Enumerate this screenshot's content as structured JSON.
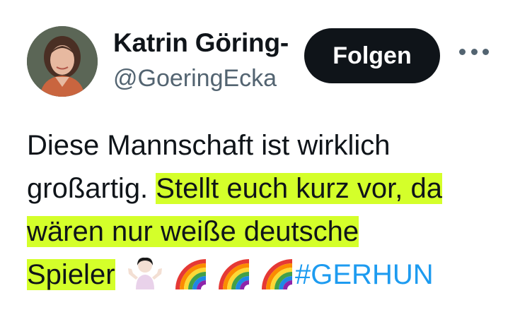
{
  "header": {
    "display_name": "Katrin Göring-",
    "handle": "@GoeringEcka",
    "follow_label": "Folgen",
    "avatar_icon": "profile-photo",
    "more_icon": "more-options-icon"
  },
  "tweet": {
    "line1": "Diese Mannschaft ist wirklich",
    "line2_plain": "großartig. ",
    "line2_highlight": "Stellt euch kurz vor, da",
    "line3_highlight": "wären nur weiße deutsche",
    "line4_highlight": "Spieler",
    "emojis": [
      "person-shrugging-emoji",
      "rainbow-emoji",
      "rainbow-emoji",
      "rainbow-emoji"
    ],
    "hashtag": "#GERHUN"
  },
  "colors": {
    "highlight": "#d4ff2a",
    "hashtag": "#1d9bf0",
    "text": "#0f1419",
    "secondary": "#536471",
    "button": "#0f1419"
  }
}
